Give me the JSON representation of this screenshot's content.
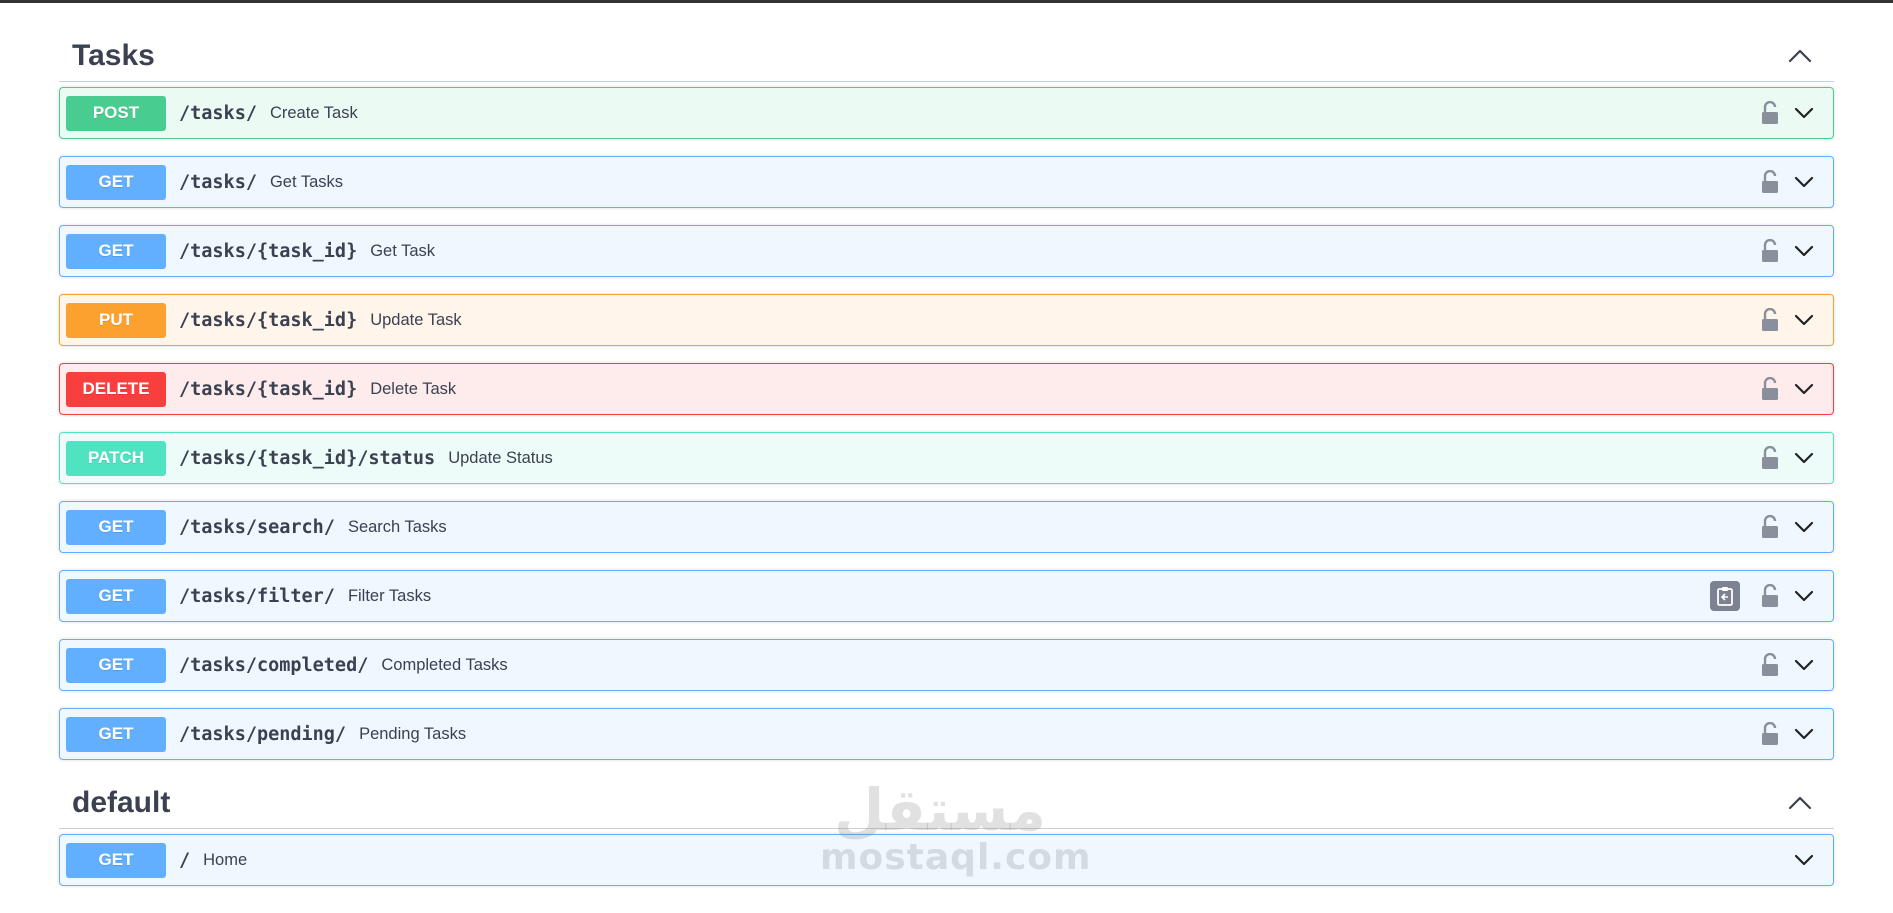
{
  "sections": [
    {
      "title": "Tasks",
      "operations": [
        {
          "method": "POST",
          "path": "/tasks/",
          "summary": "Create Task"
        },
        {
          "method": "GET",
          "path": "/tasks/",
          "summary": "Get Tasks"
        },
        {
          "method": "GET",
          "path": "/tasks/{task_id}",
          "summary": "Get Task"
        },
        {
          "method": "PUT",
          "path": "/tasks/{task_id}",
          "summary": "Update Task"
        },
        {
          "method": "DELETE",
          "path": "/tasks/{task_id}",
          "summary": "Delete Task"
        },
        {
          "method": "PATCH",
          "path": "/tasks/{task_id}/status",
          "summary": "Update Status"
        },
        {
          "method": "GET",
          "path": "/tasks/search/",
          "summary": "Search Tasks"
        },
        {
          "method": "GET",
          "path": "/tasks/filter/",
          "summary": "Filter Tasks"
        },
        {
          "method": "GET",
          "path": "/tasks/completed/",
          "summary": "Completed Tasks"
        },
        {
          "method": "GET",
          "path": "/tasks/pending/",
          "summary": "Pending Tasks"
        }
      ]
    },
    {
      "title": "default",
      "operations": [
        {
          "method": "GET",
          "path": "/",
          "summary": "Home"
        }
      ]
    }
  ],
  "watermark": {
    "arabic": "مستقل",
    "latin": "mostaql.com"
  },
  "colors": {
    "post": "#49cc90",
    "get": "#61affe",
    "put": "#fca130",
    "delete": "#f93e3e",
    "patch": "#50e3c2",
    "text": "#3b4151"
  },
  "icons": [
    "chevron-up-icon",
    "chevron-down-icon",
    "unlock-icon",
    "copy-clipboard-icon"
  ]
}
